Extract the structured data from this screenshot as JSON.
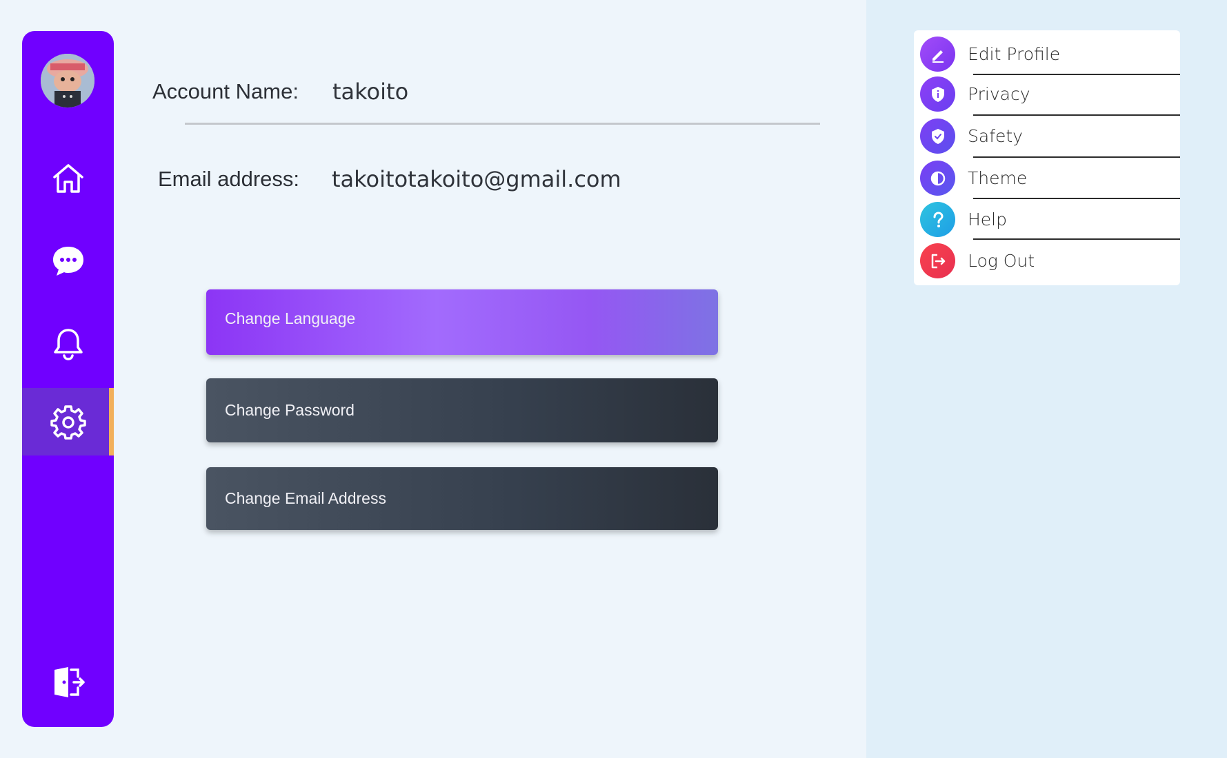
{
  "sidebar": {
    "avatar_alt": "User avatar",
    "items": [
      {
        "name": "home",
        "icon": "home-icon"
      },
      {
        "name": "messages",
        "icon": "chat-icon"
      },
      {
        "name": "notifications",
        "icon": "bell-icon"
      },
      {
        "name": "settings",
        "icon": "gear-icon",
        "active": true
      }
    ],
    "logout_icon": "logout-door-icon"
  },
  "account": {
    "name_label": "Account Name:",
    "name_value": "takoito",
    "email_label": "Email address:",
    "email_value": "takoitotakoito@gmail.com"
  },
  "actions": {
    "change_language": "Change Language",
    "change_password": "Change Password",
    "change_email": "Change Email Address"
  },
  "settings_menu": {
    "items": [
      {
        "label": "Edit Profile",
        "icon": "pencil-icon",
        "color": "#8b3cf7"
      },
      {
        "label": "Privacy",
        "icon": "shield-info-icon",
        "color": "#7b3ff2"
      },
      {
        "label": "Safety",
        "icon": "shield-check-icon",
        "color": "#6c48ef"
      },
      {
        "label": "Theme",
        "icon": "contrast-icon",
        "color": "#6d4cf0"
      },
      {
        "label": "Help",
        "icon": "question-icon",
        "color": "#23b6e0"
      },
      {
        "label": "Log Out",
        "icon": "logout-icon",
        "color": "#f2394b"
      }
    ]
  },
  "colors": {
    "sidebar": "#7000ff",
    "active_indicator": "#f2b05a",
    "accent_purple": "#9a5cfb",
    "dark_button": "#3a4350"
  }
}
